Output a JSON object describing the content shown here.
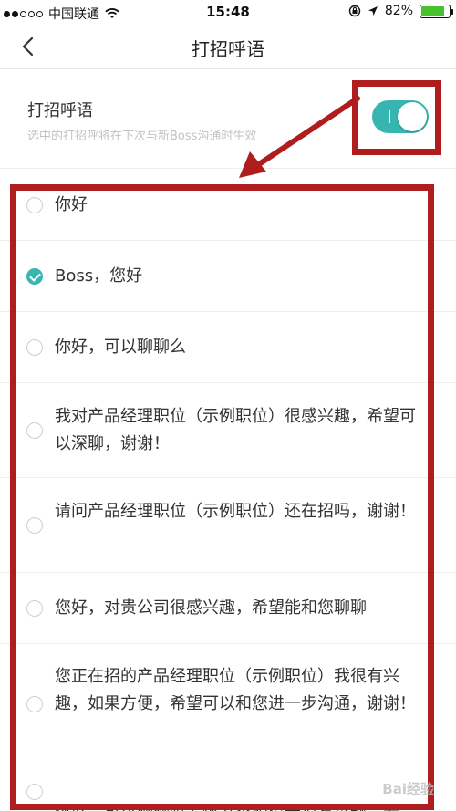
{
  "status_bar": {
    "carrier": "中国联通",
    "time": "15:48",
    "battery": "82%",
    "battery_level": 0.82
  },
  "nav": {
    "title": "打招呼语"
  },
  "greeting_setting": {
    "label": "打招呼语",
    "hint": "选中的打招呼将在下次与新Boss沟通时生效",
    "enabled": true
  },
  "options": [
    {
      "text": "你好",
      "selected": false
    },
    {
      "text": "Boss，您好",
      "selected": true
    },
    {
      "text": "你好，可以聊聊么",
      "selected": false
    },
    {
      "text": "我对产品经理职位（示例职位）很感兴趣，希望可以深聊，谢谢！",
      "selected": false
    },
    {
      "text": "请问产品经理职位（示例职位）还在招吗，谢谢！",
      "selected": false
    },
    {
      "text": "您好，对贵公司很感兴趣，希望能和您聊聊",
      "selected": false
    },
    {
      "text": "您正在招的产品经理职位（示例职位）我很有兴趣，如果方便，希望可以和您进一步沟通，谢谢！",
      "selected": false
    },
    {
      "text": "您好，可以聊聊吗？您这个职位我很有兴趣，希",
      "selected": false
    }
  ],
  "watermark": "Bai经验",
  "colors": {
    "accent": "#37b5b0",
    "annotation": "#b01d1e"
  }
}
